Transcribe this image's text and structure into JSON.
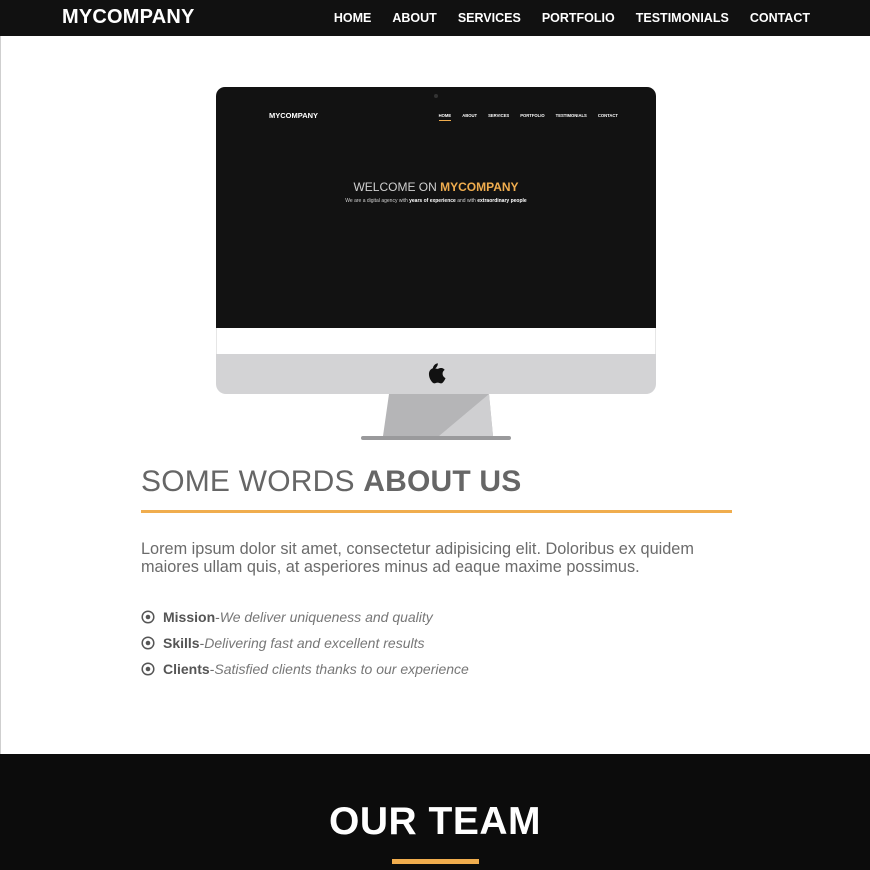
{
  "header": {
    "brand": "MYCOMPANY",
    "nav": [
      "HOME",
      "ABOUT",
      "SERVICES",
      "PORTFOLIO",
      "TESTIMONIALS",
      "CONTACT"
    ]
  },
  "mockup": {
    "brand": "MYCOMPANY",
    "nav": [
      "HOME",
      "ABOUT",
      "SERVICES",
      "PORTFOLIO",
      "TESTIMONIALS",
      "CONTACT"
    ],
    "hero_prefix": "WELCOME ON ",
    "hero_brand": "MYCOMPANY",
    "sub_1": "We are a digital agency with ",
    "sub_2": "years of experience",
    "sub_3": " and with ",
    "sub_4": "extraordinary people",
    "logo_icon": "apple-logo-icon"
  },
  "about": {
    "title_light": "SOME WORDS ",
    "title_bold": "ABOUT US",
    "text": "Lorem ipsum dolor sit amet, consectetur adipisicing elit. Doloribus ex quidem maiores ullam quis, at asperiores minus ad eaque maxime possimus.",
    "bullets": [
      {
        "title": "Mission",
        "sep": " - ",
        "desc": "We deliver uniqueness and quality"
      },
      {
        "title": "Skills",
        "sep": " - ",
        "desc": "Delivering fast and excellent results"
      },
      {
        "title": "Clients",
        "sep": " - ",
        "desc": "Satisfied clients thanks to our experience"
      }
    ]
  },
  "team": {
    "title": "OUR TEAM"
  },
  "colors": {
    "accent": "#f0ad4e",
    "dark": "#111111"
  }
}
